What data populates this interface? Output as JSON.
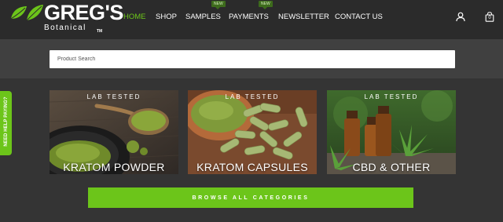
{
  "brand": {
    "name": "GREG'S",
    "subtitle": "Botanical",
    "trademark": "TM",
    "accent_color": "#6cc51a"
  },
  "nav": {
    "items": [
      {
        "label": "HOME",
        "active": true
      },
      {
        "label": "SHOP"
      },
      {
        "label": "SAMPLES",
        "badge": "NEW"
      },
      {
        "label": "PAYMENTS",
        "badge": "NEW"
      },
      {
        "label": "NEWSLETTER"
      },
      {
        "label": "CONTACT US"
      }
    ],
    "icons": [
      "user-icon",
      "cart-icon"
    ],
    "cart_count": "0"
  },
  "search": {
    "placeholder": "Product Search",
    "value": ""
  },
  "side_tab": {
    "label": "NEED HELP PAYING?"
  },
  "categories": [
    {
      "tag": "LAB TESTED",
      "title": "KRATOM POWDER"
    },
    {
      "tag": "LAB TESTED",
      "title": "KRATOM CAPSULES"
    },
    {
      "tag": "LAB TESTED",
      "title": "CBD & OTHER"
    }
  ],
  "browse_button": {
    "label": "BROWSE ALL CATEGORIES"
  }
}
